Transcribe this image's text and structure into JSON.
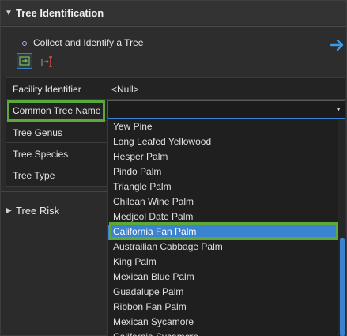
{
  "header": {
    "title": "Tree Identification"
  },
  "task": {
    "title": "Collect and Identify a Tree"
  },
  "attributes": {
    "rows": [
      {
        "label": "Facility Identifier",
        "value": "<Null>"
      },
      {
        "label": "Common Tree Name",
        "value": ""
      },
      {
        "label": "Tree Genus",
        "value": ""
      },
      {
        "label": "Tree Species",
        "value": ""
      },
      {
        "label": "Tree Type",
        "value": ""
      }
    ]
  },
  "combo": {
    "value": ""
  },
  "dropdown": {
    "selected": "California Fan Palm",
    "items": [
      "Yew Pine",
      "Long Leafed Yellowood",
      "Hesper Palm",
      "Pindo Palm",
      "Triangle Palm",
      "Chilean Wine Palm",
      "Medjool Date Palm",
      "California Fan Palm",
      "Austrailian Cabbage Palm",
      "King Palm",
      "Mexican Blue Palm",
      "Guadalupe Palm",
      "Ribbon Fan Palm",
      "Mexican Sycamore",
      "California Sycamore"
    ]
  },
  "risk": {
    "title": "Tree Risk"
  },
  "colors": {
    "accent": "#3b82d0",
    "highlight": "#5aa93a",
    "background": "#2b2b2b"
  }
}
